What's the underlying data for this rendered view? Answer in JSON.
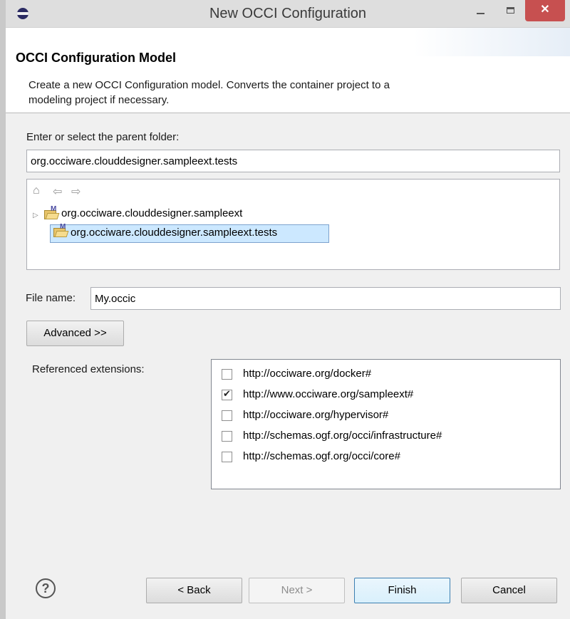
{
  "window": {
    "title": "New OCCI Configuration",
    "controls": {
      "minimize": "−",
      "maximize": "□",
      "close": "✕"
    }
  },
  "banner": {
    "title": "OCCI Configuration Model",
    "description": "Create a new OCCI Configuration model. Converts the container project to a modeling project if necessary."
  },
  "folder": {
    "label": "Enter or select the parent folder:",
    "value": "org.occiware.clouddesigner.sampleext.tests",
    "nav": [
      "home-icon",
      "back-arrow-icon",
      "forward-arrow-icon"
    ],
    "tree": [
      {
        "label": "org.occiware.clouddesigner.sampleext",
        "expanded": false,
        "selected": false
      },
      {
        "label": "org.occiware.clouddesigner.sampleext.tests",
        "selected": true
      }
    ]
  },
  "file": {
    "label": "File name:",
    "value": "My.occic"
  },
  "advanced_button": "Advanced >>",
  "extensions": {
    "label": "Referenced extensions:",
    "items": [
      {
        "label": "http://occiware.org/docker#",
        "checked": false
      },
      {
        "label": "http://www.occiware.org/sampleext#",
        "checked": true
      },
      {
        "label": "http://occiware.org/hypervisor#",
        "checked": false
      },
      {
        "label": "http://schemas.ogf.org/occi/infrastructure#",
        "checked": false
      },
      {
        "label": "http://schemas.ogf.org/occi/core#",
        "checked": false
      }
    ]
  },
  "buttons": {
    "help": "?",
    "back": "< Back",
    "next": "Next >",
    "finish": "Finish",
    "cancel": "Cancel"
  },
  "colors": {
    "close_button": "#c75050",
    "selection": "#cce8ff"
  }
}
